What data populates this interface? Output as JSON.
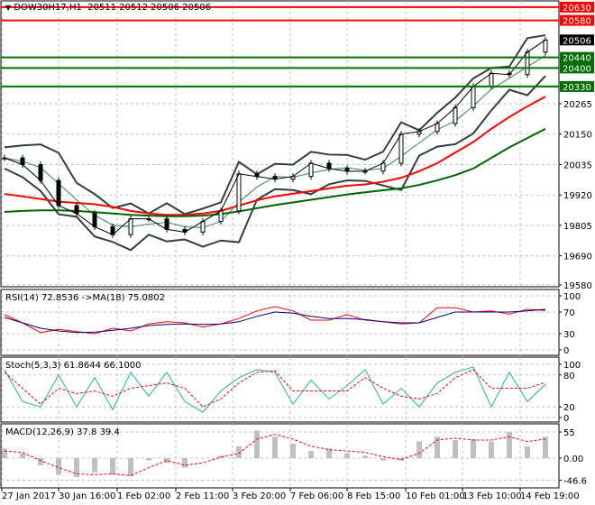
{
  "header": {
    "symbol_title": "DOW30H17,H1",
    "ohlc": "20511 20512 20506 20506"
  },
  "colors": {
    "resistance": "#ff0000",
    "support": "#007000",
    "price_line": "#000000",
    "ma_slow": "#ff0000",
    "ma_fast": "#006400",
    "bands": "#2f3f3f",
    "rsi": "#ff0000",
    "rsi_ma": "#000080",
    "stoch_main": "#20b2aa",
    "stoch_signal": "#ff0000",
    "macd_hist": "#c0c0c0",
    "macd_signal": "#ff0000"
  },
  "chart_data": [
    {
      "type": "line",
      "panel": "price",
      "title": "DOW30H17,H1  20511 20512 20506 20506",
      "x_tick_labels": [
        "27 Jan 2017",
        "30 Jan 16:00",
        "1 Feb 02:00",
        "2 Feb 11:00",
        "3 Feb 20:00",
        "7 Feb 06:00",
        "8 Feb 15:00",
        "10 Feb 01:00",
        "13 Feb 10:00",
        "14 Feb 19:00"
      ],
      "y_tick_labels": [
        "20265",
        "20150",
        "20035",
        "19920",
        "19805",
        "19690",
        "19580"
      ],
      "ylim": [
        19580,
        20640
      ],
      "grid": true,
      "levels": [
        {
          "label": "20630",
          "value": 20630,
          "kind": "resistance"
        },
        {
          "label": "20580",
          "value": 20580,
          "kind": "resistance"
        },
        {
          "label": "20440",
          "value": 20440,
          "kind": "support"
        },
        {
          "label": "20400",
          "value": 20400,
          "kind": "support"
        },
        {
          "label": "20330",
          "value": 20330,
          "kind": "support"
        }
      ],
      "current_price": {
        "label": "20506",
        "value": 20506
      },
      "series": [
        {
          "key": "close",
          "values": [
            20060,
            20035,
            19975,
            19880,
            19850,
            19800,
            19770,
            19830,
            19830,
            19790,
            19780,
            19820,
            19860,
            20000,
            19990,
            19980,
            19990,
            20040,
            20020,
            20010,
            20010,
            20040,
            20150,
            20160,
            20190,
            20250,
            20330,
            20380,
            20375,
            20460,
            20506
          ]
        },
        {
          "key": "ma_slow",
          "values": [
            19924,
            19915,
            19905,
            19895,
            19890,
            19885,
            19875,
            19860,
            19850,
            19845,
            19845,
            19850,
            19860,
            19880,
            19900,
            19915,
            19925,
            19935,
            19945,
            19955,
            19960,
            19970,
            19985,
            20010,
            20040,
            20080,
            20120,
            20170,
            20215,
            20255,
            20292
          ]
        },
        {
          "key": "ma_fast",
          "values": [
            19856,
            19860,
            19862,
            19862,
            19860,
            19855,
            19850,
            19845,
            19842,
            19840,
            19840,
            19842,
            19848,
            19858,
            19870,
            19882,
            19892,
            19902,
            19912,
            19922,
            19930,
            19938,
            19945,
            19958,
            19975,
            19995,
            20020,
            20060,
            20100,
            20135,
            20170
          ]
        }
      ]
    },
    {
      "type": "line",
      "panel": "rsi",
      "title": "RSI(14) 72.8536  ->MA(18) 75.0802",
      "y_tick_labels": [
        "100",
        "70",
        "30",
        "0"
      ],
      "ylim": [
        0,
        100
      ],
      "grid": true,
      "series": [
        {
          "key": "rsi",
          "values": [
            65,
            50,
            32,
            38,
            34,
            30,
            40,
            35,
            48,
            52,
            50,
            42,
            48,
            58,
            72,
            80,
            72,
            55,
            55,
            65,
            55,
            52,
            48,
            50,
            78,
            78,
            70,
            72,
            66,
            75,
            73
          ]
        },
        {
          "key": "rsi_ma",
          "values": [
            60,
            50,
            40,
            35,
            32,
            33,
            36,
            40,
            45,
            47,
            48,
            47,
            48,
            52,
            62,
            70,
            68,
            62,
            58,
            58,
            56,
            52,
            50,
            50,
            60,
            70,
            70,
            70,
            70,
            72,
            75
          ]
        }
      ]
    },
    {
      "type": "line",
      "panel": "stoch",
      "title": "Stoch(5,3,3) 61.8644 66.1000",
      "y_tick_labels": [
        "100",
        "80",
        "20",
        "0"
      ],
      "ylim": [
        0,
        100
      ],
      "grid": true,
      "series": [
        {
          "key": "main",
          "values": [
            90,
            30,
            20,
            80,
            20,
            75,
            15,
            85,
            40,
            85,
            30,
            10,
            50,
            75,
            90,
            85,
            25,
            70,
            35,
            60,
            90,
            25,
            55,
            20,
            65,
            85,
            95,
            20,
            85,
            30,
            62
          ]
        },
        {
          "key": "signal",
          "values": [
            85,
            55,
            25,
            55,
            45,
            50,
            40,
            55,
            60,
            65,
            55,
            20,
            35,
            65,
            85,
            88,
            50,
            50,
            50,
            50,
            75,
            55,
            40,
            35,
            45,
            75,
            90,
            55,
            55,
            55,
            66
          ]
        }
      ]
    },
    {
      "type": "bar",
      "panel": "macd",
      "title": "MACD(12,26,9) 37.8 39.4",
      "y_tick_labels": [
        "55",
        "0.00",
        "-46.6"
      ],
      "ylim": [
        -55,
        60
      ],
      "grid": true,
      "series": [
        {
          "key": "macd",
          "values": [
            20,
            10,
            -15,
            -35,
            -40,
            -30,
            -35,
            -38,
            -5,
            -10,
            -20,
            0,
            5,
            25,
            58,
            45,
            30,
            15,
            20,
            10,
            5,
            -5,
            -5,
            35,
            45,
            38,
            40,
            35,
            55,
            25,
            45
          ]
        },
        {
          "key": "signal",
          "values": [
            15,
            12,
            -5,
            -20,
            -33,
            -35,
            -33,
            -37,
            -20,
            -5,
            -15,
            -10,
            2,
            10,
            40,
            50,
            40,
            25,
            18,
            15,
            12,
            3,
            -3,
            10,
            38,
            42,
            38,
            38,
            45,
            35,
            40
          ]
        }
      ]
    }
  ]
}
